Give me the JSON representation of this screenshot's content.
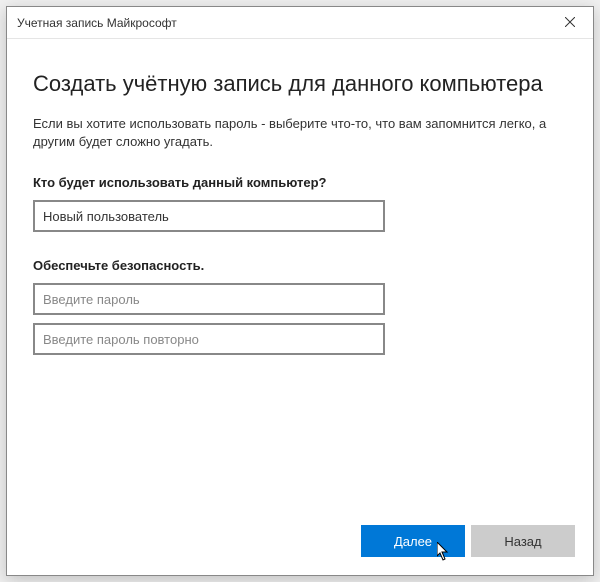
{
  "window": {
    "title": "Учетная запись Майкрософт"
  },
  "main": {
    "heading": "Создать учётную запись для данного компьютера",
    "description": "Если вы хотите использовать пароль - выберите что-то, что вам запомнится легко, а другим будет сложно угадать.",
    "section1_label": "Кто будет использовать данный компьютер?",
    "username_value": "Новый пользователь",
    "section2_label": "Обеспечьте безопасность.",
    "password_placeholder": "Введите пароль",
    "password_confirm_placeholder": "Введите пароль повторно"
  },
  "footer": {
    "next": "Далее",
    "back": "Назад"
  },
  "colors": {
    "primary": "#0078d7"
  }
}
